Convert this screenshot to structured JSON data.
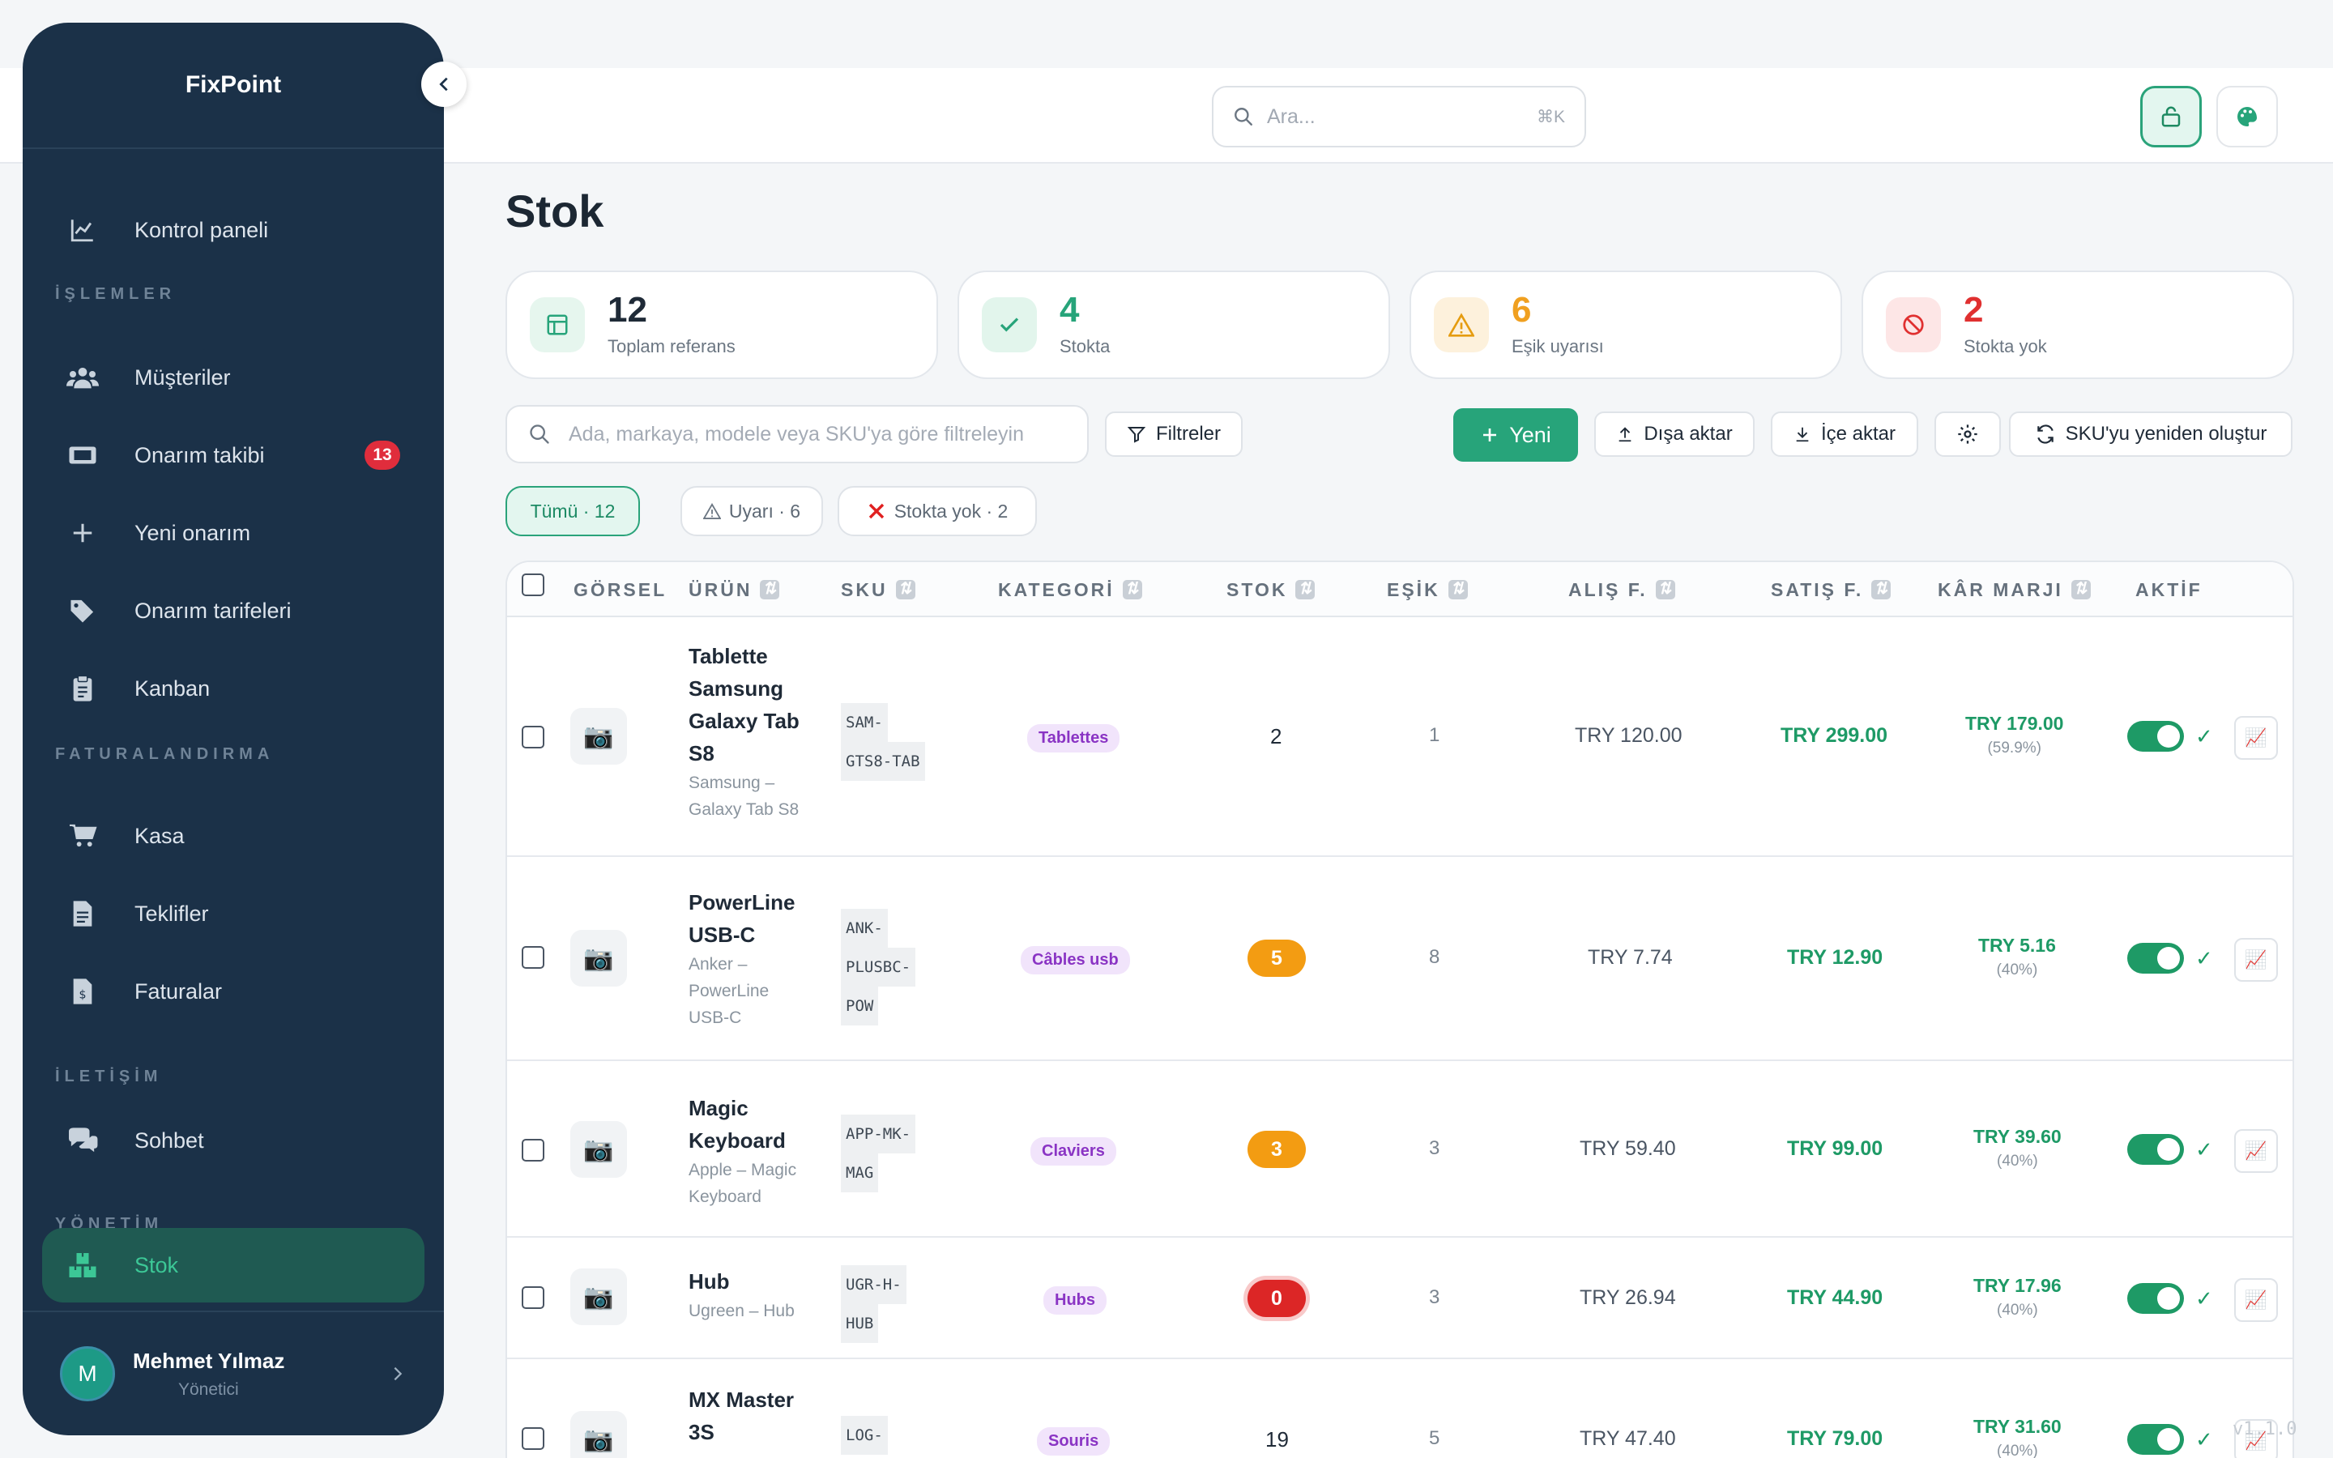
{
  "app": {
    "name": "FixPoint",
    "version": "v1.1.0"
  },
  "topbar": {
    "search_placeholder": "Ara...",
    "search_shortcut": "⌘K"
  },
  "sidebar": {
    "sections": {
      "operations": "İŞLEMLER",
      "billing": "FATURALANDIRMA",
      "communication": "İLETİŞİM",
      "management": "YÖNETİM"
    },
    "items": [
      {
        "label": "Kontrol paneli",
        "icon": "chart-line-icon"
      },
      {
        "label": "Müşteriler",
        "icon": "users-icon"
      },
      {
        "label": "Onarım takibi",
        "icon": "ticket-icon",
        "badge": "13"
      },
      {
        "label": "Yeni onarım",
        "icon": "plus-icon"
      },
      {
        "label": "Onarım tarifeleri",
        "icon": "tags-icon"
      },
      {
        "label": "Kanban",
        "icon": "clipboard-icon"
      },
      {
        "label": "Kasa",
        "icon": "cart-icon"
      },
      {
        "label": "Teklifler",
        "icon": "document-icon"
      },
      {
        "label": "Faturalar",
        "icon": "invoice-icon"
      },
      {
        "label": "Sohbet",
        "icon": "chat-icon"
      },
      {
        "label": "Stok",
        "icon": "boxes-icon",
        "active": true
      }
    ],
    "user": {
      "initial": "M",
      "name": "Mehmet Yılmaz",
      "role": "Yönetici"
    }
  },
  "page": {
    "title": "Stok"
  },
  "stats": [
    {
      "value": "12",
      "label": "Toplam referans",
      "color": "#1f2a37"
    },
    {
      "value": "4",
      "label": "Stokta",
      "color": "#27a47a"
    },
    {
      "value": "6",
      "label": "Eşik uyarısı",
      "color": "#f0a020"
    },
    {
      "value": "2",
      "label": "Stokta yok",
      "color": "#e03030"
    }
  ],
  "toolbar": {
    "filter_placeholder": "Ada, markaya, modele veya SKU'ya göre filtreleyin",
    "filters": "Filtreler",
    "new": "Yeni",
    "export": "Dışa aktar",
    "import": "İçe aktar",
    "regen_sku": "SKU'yu yeniden oluştur"
  },
  "chips": {
    "all": "Tümü · 12",
    "warning": "Uyarı · 6",
    "out": "Stokta yok · 2"
  },
  "table": {
    "headers": [
      "GÖRSEL",
      "ÜRÜN",
      "SKU",
      "KATEGORİ",
      "STOK",
      "EŞİK",
      "ALIŞ F.",
      "SATIŞ F.",
      "KÂR MARJI",
      "AKTİF"
    ],
    "rows": [
      {
        "name": [
          "Tablette",
          "Samsung",
          "Galaxy Tab",
          "S8"
        ],
        "sub": [
          "Samsung –",
          "Galaxy Tab S8"
        ],
        "sku": [
          "SAM-",
          "GTS8-TAB"
        ],
        "category": "Tablettes",
        "stock": "2",
        "stock_state": "ok",
        "threshold": "1",
        "buy": "TRY 120.00",
        "sell": "TRY 299.00",
        "margin": "TRY 179.00",
        "margin_pct": "(59.9%)"
      },
      {
        "name": [
          "PowerLine",
          "USB-C"
        ],
        "sub": [
          "Anker –",
          "PowerLine",
          "USB-C"
        ],
        "sku": [
          "ANK-",
          "PLUSBC-",
          "POW"
        ],
        "category": "Câbles usb",
        "stock": "5",
        "stock_state": "warn",
        "threshold": "8",
        "buy": "TRY 7.74",
        "sell": "TRY 12.90",
        "margin": "TRY 5.16",
        "margin_pct": "(40%)"
      },
      {
        "name": [
          "Magic",
          "Keyboard"
        ],
        "sub": [
          "Apple – Magic",
          "Keyboard"
        ],
        "sku": [
          "APP-MK-",
          "MAG"
        ],
        "category": "Claviers",
        "stock": "3",
        "stock_state": "warn",
        "threshold": "3",
        "buy": "TRY 59.40",
        "sell": "TRY 99.00",
        "margin": "TRY 39.60",
        "margin_pct": "(40%)"
      },
      {
        "name": [
          "Hub"
        ],
        "sub": [
          "Ugreen – Hub"
        ],
        "sku": [
          "UGR-H-",
          "HUB"
        ],
        "category": "Hubs",
        "stock": "0",
        "stock_state": "out",
        "threshold": "3",
        "buy": "TRY 26.94",
        "sell": "TRY 44.90",
        "margin": "TRY 17.96",
        "margin_pct": "(40%)"
      },
      {
        "name": [
          "MX Master",
          "3S"
        ],
        "sub": [],
        "sku": [
          "LOG-"
        ],
        "category": "Souris",
        "stock": "19",
        "stock_state": "ok",
        "threshold": "5",
        "buy": "TRY 47.40",
        "sell": "TRY 79.00",
        "margin": "TRY 31.60",
        "margin_pct": "(40%)"
      }
    ]
  }
}
